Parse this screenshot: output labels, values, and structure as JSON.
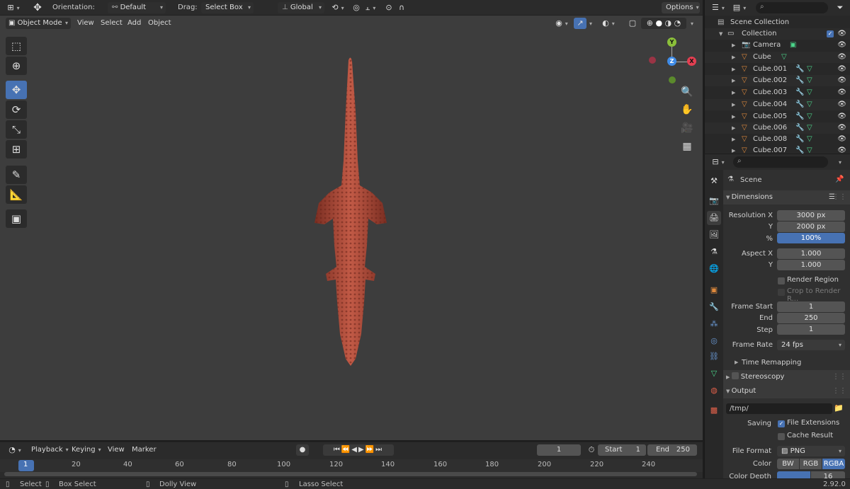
{
  "top_header": {
    "orientation_label": "Orientation:",
    "orientation_value": "Default",
    "drag_label": "Drag:",
    "drag_value": "Select Box",
    "transform_value": "Global",
    "options_label": "Options"
  },
  "viewport_header": {
    "mode": "Object Mode",
    "menus": [
      "View",
      "Select",
      "Add",
      "Object"
    ]
  },
  "gizmo": {
    "x": "X",
    "y": "Y",
    "z": "Z",
    "colors": {
      "x": "#e33f51",
      "y": "#8bbf3a",
      "z": "#3f8ce8"
    }
  },
  "timeline": {
    "menus": [
      "Playback",
      "Keying",
      "View",
      "Marker"
    ],
    "current_frame": "1",
    "start_label": "Start",
    "start_value": "1",
    "end_label": "End",
    "end_value": "250",
    "ticks": [
      "1",
      "20",
      "40",
      "60",
      "80",
      "100",
      "120",
      "140",
      "160",
      "180",
      "200",
      "220",
      "240"
    ]
  },
  "statusbar": {
    "select": "Select",
    "box_select": "Box Select",
    "dolly_view": "Dolly View",
    "lasso_select": "Lasso Select",
    "version": "2.92.0"
  },
  "outliner": {
    "scene_collection": "Scene Collection",
    "collection": "Collection",
    "objects": [
      "Camera",
      "Cube",
      "Cube.001",
      "Cube.002",
      "Cube.003",
      "Cube.004",
      "Cube.005",
      "Cube.006",
      "Cube.007",
      "Cube.008"
    ]
  },
  "properties": {
    "scene_label": "Scene",
    "dimensions": {
      "title": "Dimensions",
      "resolution_x_label": "Resolution X",
      "resolution_x": "3000 px",
      "y_label": "Y",
      "resolution_y": "2000 px",
      "percent_label": "%",
      "percent": "100%",
      "aspect_x_label": "Aspect X",
      "aspect_x": "1.000",
      "aspect_y_label": "Y",
      "aspect_y": "1.000",
      "render_region": "Render Region",
      "crop_to_render": "Crop to Render R...",
      "frame_start_label": "Frame Start",
      "frame_start": "1",
      "end_label": "End",
      "frame_end": "250",
      "step_label": "Step",
      "frame_step": "1",
      "frame_rate_label": "Frame Rate",
      "frame_rate": "24 fps",
      "time_remapping": "Time Remapping"
    },
    "stereoscopy": "Stereoscopy",
    "output": {
      "title": "Output",
      "path": "/tmp/",
      "saving_label": "Saving",
      "file_extensions": "File Extensions",
      "cache_result": "Cache Result",
      "file_format_label": "File Format",
      "file_format": "PNG",
      "color_label": "Color",
      "color_options": [
        "BW",
        "RGB",
        "RGBA"
      ],
      "color_depth_label": "Color Depth",
      "color_depth_value": "16"
    }
  }
}
